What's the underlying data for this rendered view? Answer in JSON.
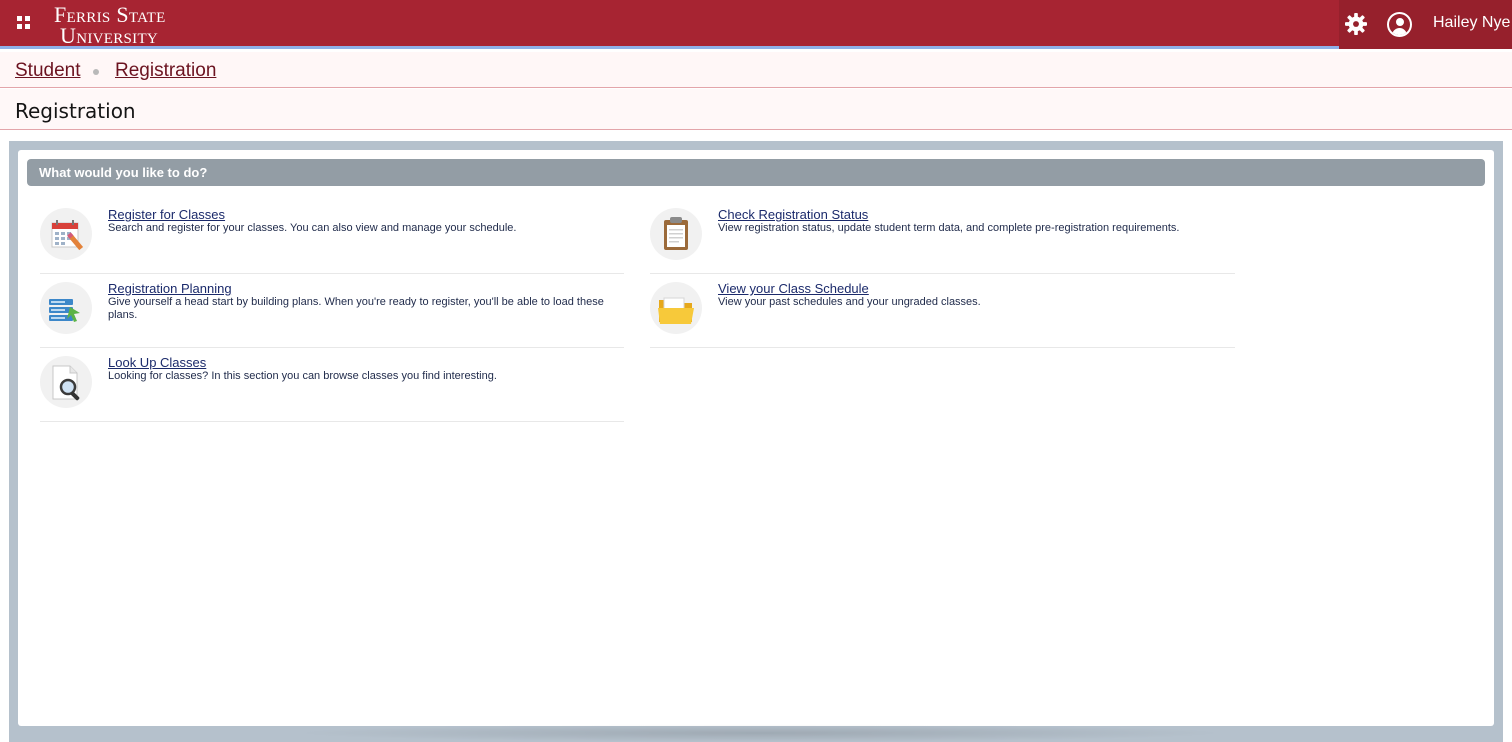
{
  "header": {
    "logo_line1": "Ferris State",
    "logo_line2": "University",
    "user_name": "Hailey Nye",
    "icons": {
      "menu": "grid-icon",
      "settings": "gear-icon",
      "user": "user-avatar-icon"
    }
  },
  "breadcrumb": {
    "items": [
      {
        "label": "Student"
      },
      {
        "label": "Registration"
      }
    ]
  },
  "page": {
    "title": "Registration"
  },
  "panel": {
    "header": "What would you like to do?",
    "items": [
      {
        "title": "Register for Classes",
        "description": "Search and register for your classes. You can also view and manage your schedule.",
        "icon": "calendar-pencil-icon"
      },
      {
        "title": "Check Registration Status",
        "description": "View registration status, update student term data, and complete pre-registration requirements.",
        "icon": "clipboard-icon"
      },
      {
        "title": "Registration Planning",
        "description": "Give yourself a head start by building plans. When you're ready to register, you'll be able to load these plans.",
        "icon": "plan-list-icon"
      },
      {
        "title": "View your Class Schedule",
        "description": "View your past schedules and your ungraded classes.",
        "icon": "folder-icon"
      },
      {
        "title": "Look Up Classes",
        "description": "Looking for classes? In this section you can browse classes you find interesting.",
        "icon": "document-search-icon"
      }
    ]
  },
  "colors": {
    "brand_red": "#a72432",
    "panel_header": "#939da5",
    "link": "#1b2a6b"
  }
}
